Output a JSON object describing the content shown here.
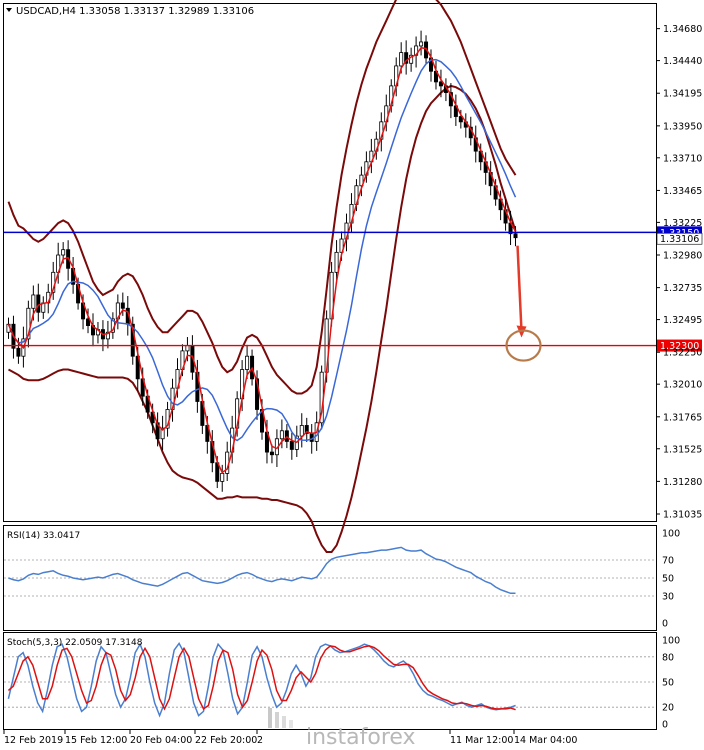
{
  "chart_data": {
    "type": "candlestick",
    "symbol_header": "USDCAD,H4  1.33058 1.33137 1.32989 1.33106",
    "price_axis": {
      "ticks": [
        "1.34680",
        "1.34440",
        "1.34195",
        "1.33950",
        "1.33710",
        "1.33465",
        "1.33225",
        "1.32980",
        "1.32735",
        "1.32495",
        "1.32250",
        "1.32010",
        "1.31765",
        "1.31525",
        "1.31280",
        "1.31035"
      ],
      "ylim": [
        1.31005,
        1.34835
      ]
    },
    "levels": [
      {
        "value": 1.3315,
        "label": "1.33150",
        "color": "#0000cc"
      },
      {
        "value": 1.323,
        "label": "1.32300",
        "color": "#ee0000"
      }
    ],
    "current_price": {
      "value": 1.33106,
      "label": "1.33106"
    },
    "time_axis": [
      "12 Feb 2019",
      "15 Feb 12:00",
      "20 Feb 04:00",
      "22 Feb 20:00",
      "2",
      "11 Mar 12:00",
      "14 Mar 04:00"
    ],
    "candles_close": [
      1.3246,
      1.3228,
      1.3222,
      1.3235,
      1.3258,
      1.3268,
      1.3255,
      1.3262,
      1.327,
      1.3285,
      1.3298,
      1.3302,
      1.3288,
      1.3276,
      1.3262,
      1.325,
      1.3245,
      1.3238,
      1.3242,
      1.3235,
      1.324,
      1.325,
      1.3262,
      1.3258,
      1.3246,
      1.3222,
      1.3205,
      1.3192,
      1.318,
      1.3172,
      1.316,
      1.3168,
      1.3182,
      1.3198,
      1.3212,
      1.3226,
      1.323,
      1.321,
      1.3188,
      1.317,
      1.3158,
      1.3142,
      1.3128,
      1.3134,
      1.315,
      1.3168,
      1.319,
      1.3212,
      1.3222,
      1.3205,
      1.3182,
      1.3165,
      1.315,
      1.3148,
      1.316,
      1.3166,
      1.3158,
      1.3152,
      1.3162,
      1.317,
      1.3164,
      1.3158,
      1.3172,
      1.321,
      1.325,
      1.3285,
      1.33,
      1.331,
      1.3322,
      1.3336,
      1.335,
      1.3358,
      1.3368,
      1.3376,
      1.3385,
      1.3398,
      1.341,
      1.3425,
      1.344,
      1.345,
      1.3442,
      1.3448,
      1.3455,
      1.3458,
      1.3446,
      1.3436,
      1.3428,
      1.3425,
      1.342,
      1.341,
      1.3402,
      1.3398,
      1.3394,
      1.3386,
      1.3376,
      1.3368,
      1.336,
      1.335,
      1.334,
      1.3332,
      1.3322,
      1.3314,
      1.3311
    ],
    "bollinger_upper": [
      1.3338,
      1.3328,
      1.332,
      1.3318,
      1.3314,
      1.331,
      1.3308,
      1.331,
      1.3314,
      1.3318,
      1.3322,
      1.3324,
      1.3322,
      1.3316,
      1.3308,
      1.3298,
      1.3288,
      1.3278,
      1.3272,
      1.3268,
      1.327,
      1.3272,
      1.3278,
      1.3282,
      1.3284,
      1.3282,
      1.3276,
      1.3268,
      1.3258,
      1.325,
      1.3244,
      1.324,
      1.324,
      1.3244,
      1.3248,
      1.3252,
      1.3256,
      1.3256,
      1.3254,
      1.3248,
      1.324,
      1.3232,
      1.3222,
      1.3214,
      1.321,
      1.3212,
      1.3218,
      1.3228,
      1.3236,
      1.3238,
      1.3236,
      1.323,
      1.3222,
      1.3214,
      1.3208,
      1.3204,
      1.32,
      1.3196,
      1.3194,
      1.3194,
      1.3196,
      1.32,
      1.3214,
      1.324,
      1.3272,
      1.3306,
      1.3334,
      1.3358,
      1.3378,
      1.3396,
      1.3412,
      1.3426,
      1.3438,
      1.3448,
      1.3458,
      1.3466,
      1.3474,
      1.3482,
      1.349,
      1.3496,
      1.3498,
      1.35,
      1.3502,
      1.35,
      1.3497,
      1.3494,
      1.349,
      1.3486,
      1.348,
      1.3474,
      1.3466,
      1.3458,
      1.3448,
      1.3438,
      1.3428,
      1.3418,
      1.3408,
      1.3398,
      1.3388,
      1.3378,
      1.337,
      1.3364,
      1.3358
    ],
    "bollinger_lower": [
      1.3212,
      1.321,
      1.3208,
      1.3205,
      1.3204,
      1.3204,
      1.3204,
      1.3205,
      1.3207,
      1.3209,
      1.3211,
      1.3212,
      1.3212,
      1.3211,
      1.321,
      1.3209,
      1.3208,
      1.3207,
      1.3206,
      1.3206,
      1.3206,
      1.3206,
      1.3206,
      1.3206,
      1.3205,
      1.3202,
      1.3196,
      1.3188,
      1.318,
      1.317,
      1.316,
      1.315,
      1.3142,
      1.3136,
      1.3133,
      1.3131,
      1.313,
      1.3129,
      1.3127,
      1.3124,
      1.3121,
      1.3118,
      1.3115,
      1.3115,
      1.3116,
      1.3116,
      1.3117,
      1.3116,
      1.3116,
      1.3116,
      1.3116,
      1.3115,
      1.3115,
      1.3114,
      1.3114,
      1.3113,
      1.3112,
      1.3111,
      1.311,
      1.3108,
      1.3104,
      1.3098,
      1.3088,
      1.308,
      1.3075,
      1.3075,
      1.308,
      1.309,
      1.3102,
      1.3116,
      1.3132,
      1.315,
      1.3168,
      1.3188,
      1.321,
      1.3234,
      1.3258,
      1.3284,
      1.331,
      1.3334,
      1.3355,
      1.3372,
      1.3386,
      1.3397,
      1.3406,
      1.3412,
      1.3416,
      1.342,
      1.3423,
      1.3425,
      1.3424,
      1.3422,
      1.3419,
      1.3414,
      1.3408,
      1.34,
      1.339,
      1.3378,
      1.3366,
      1.3352,
      1.334,
      1.3328,
      1.3316
    ],
    "ma_fast_red_last": 1.333,
    "ma_slow_blue_last": 1.3348,
    "rsi": {
      "label": "RSI(14) 33.0417",
      "axis_ticks": [
        "100",
        "70",
        "50",
        "30",
        "0"
      ],
      "ylim": [
        0,
        100
      ],
      "values": [
        50,
        48,
        47,
        49,
        53,
        55,
        54,
        56,
        57,
        58,
        55,
        53,
        52,
        50,
        49,
        48,
        49,
        50,
        51,
        50,
        52,
        54,
        55,
        53,
        51,
        48,
        46,
        44,
        43,
        42,
        41,
        43,
        46,
        49,
        52,
        55,
        56,
        53,
        50,
        47,
        46,
        45,
        44,
        45,
        47,
        50,
        53,
        55,
        56,
        54,
        51,
        49,
        47,
        46,
        48,
        49,
        48,
        47,
        49,
        51,
        50,
        49,
        51,
        58,
        66,
        71,
        73,
        74,
        75,
        76,
        77,
        78,
        78,
        79,
        80,
        81,
        81,
        82,
        83,
        84,
        81,
        80,
        80,
        81,
        77,
        74,
        71,
        70,
        68,
        65,
        62,
        60,
        58,
        56,
        52,
        49,
        46,
        44,
        40,
        37,
        35,
        33,
        33
      ],
      "levels": [
        70,
        50,
        30
      ],
      "line_color": "#4a7fd0"
    },
    "stochastic": {
      "label": "Stoch(5,3,3) 22.0509 17.3148",
      "axis_ticks": [
        "100",
        "80",
        "50",
        "20",
        "0"
      ],
      "ylim": [
        0,
        100
      ],
      "k_values": [
        30,
        55,
        80,
        85,
        70,
        45,
        25,
        15,
        40,
        70,
        92,
        95,
        80,
        55,
        30,
        15,
        20,
        45,
        75,
        92,
        85,
        60,
        35,
        20,
        30,
        55,
        85,
        95,
        80,
        50,
        25,
        10,
        25,
        60,
        88,
        96,
        85,
        55,
        25,
        10,
        15,
        45,
        80,
        95,
        88,
        60,
        30,
        12,
        20,
        50,
        82,
        92,
        80,
        55,
        35,
        20,
        25,
        40,
        60,
        70,
        60,
        45,
        55,
        80,
        92,
        95,
        93,
        88,
        85,
        86,
        88,
        90,
        92,
        95,
        93,
        88,
        82,
        75,
        70,
        68,
        72,
        75,
        70,
        60,
        48,
        40,
        35,
        33,
        30,
        28,
        25,
        22,
        24,
        26,
        22,
        20,
        22,
        24,
        20,
        18,
        17,
        18,
        19,
        20,
        22
      ],
      "d_values": [
        40,
        45,
        60,
        75,
        80,
        70,
        50,
        30,
        30,
        45,
        70,
        88,
        90,
        80,
        60,
        40,
        25,
        28,
        45,
        70,
        85,
        82,
        65,
        40,
        28,
        35,
        55,
        80,
        90,
        80,
        55,
        30,
        18,
        30,
        55,
        80,
        90,
        80,
        55,
        30,
        18,
        22,
        45,
        75,
        88,
        85,
        65,
        35,
        20,
        28,
        50,
        75,
        88,
        82,
        65,
        40,
        28,
        28,
        40,
        55,
        62,
        56,
        50,
        60,
        78,
        88,
        93,
        92,
        88,
        86,
        86,
        88,
        90,
        92,
        93,
        91,
        87,
        81,
        76,
        71,
        70,
        71,
        71,
        67,
        58,
        48,
        40,
        36,
        33,
        30,
        28,
        25,
        24,
        25,
        24,
        22,
        21,
        22,
        21,
        19,
        18,
        18,
        18,
        19,
        17
      ]
    }
  },
  "watermark": {
    "text": "instaforex"
  },
  "colors": {
    "ma_fast": "#e21212",
    "ma_slow": "#3a68d8",
    "bands": "#7a0a0a",
    "arrow": "#e33a2a",
    "circle": "#b97a4a"
  }
}
